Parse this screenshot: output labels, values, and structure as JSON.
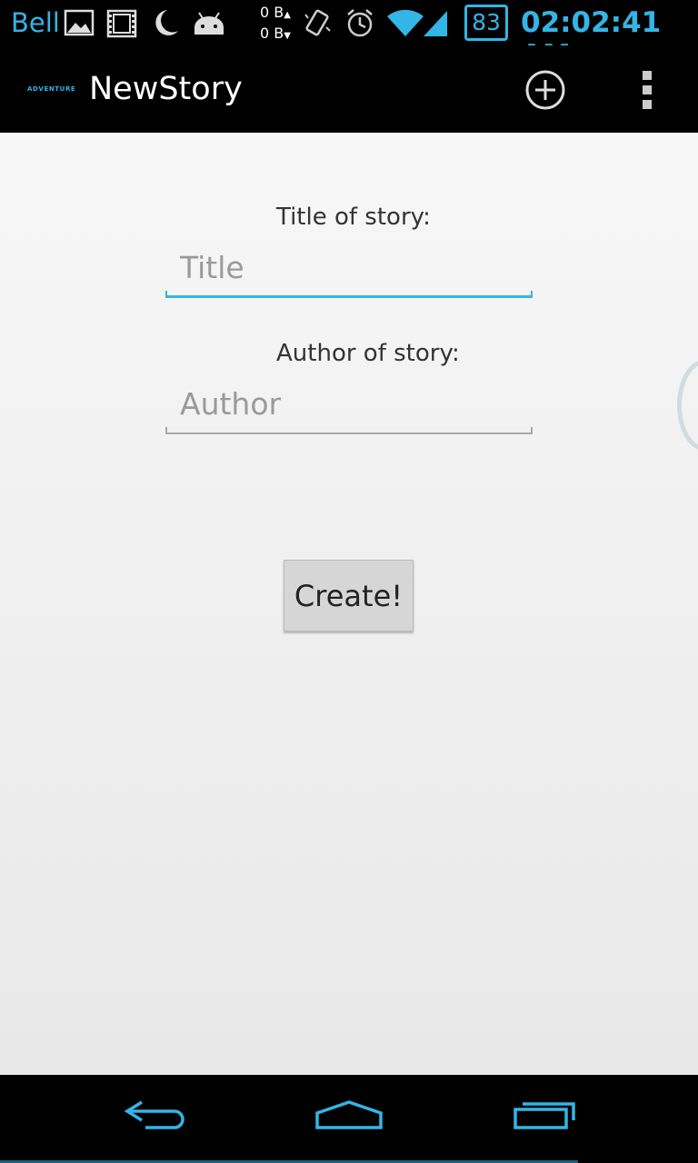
{
  "status_bar": {
    "carrier": "Bell",
    "upload": "0 B",
    "download": "0 B",
    "battery": "83",
    "time": "02:02:41 AM",
    "icons": [
      "image-icon",
      "film-icon",
      "moon-icon",
      "android-icon",
      "vibrate-icon",
      "alarm-icon",
      "wifi-icon",
      "signal-icon",
      "battery-icon"
    ]
  },
  "action_bar": {
    "logo_text": "ADVENTURE",
    "title": "NewStory",
    "actions": [
      "add-icon",
      "overflow-menu-icon"
    ]
  },
  "form": {
    "title_label": "Title of story:",
    "title_placeholder": "Title",
    "title_value": "",
    "author_label": "Author of story:",
    "author_placeholder": "Author",
    "author_value": "",
    "create_label": "Create!"
  },
  "nav_bar": {
    "buttons": [
      "back-icon",
      "home-icon",
      "recents-icon"
    ]
  },
  "colors": {
    "accent": "#33b5e5",
    "background": "#f4f4f4",
    "bars": "#000000"
  }
}
